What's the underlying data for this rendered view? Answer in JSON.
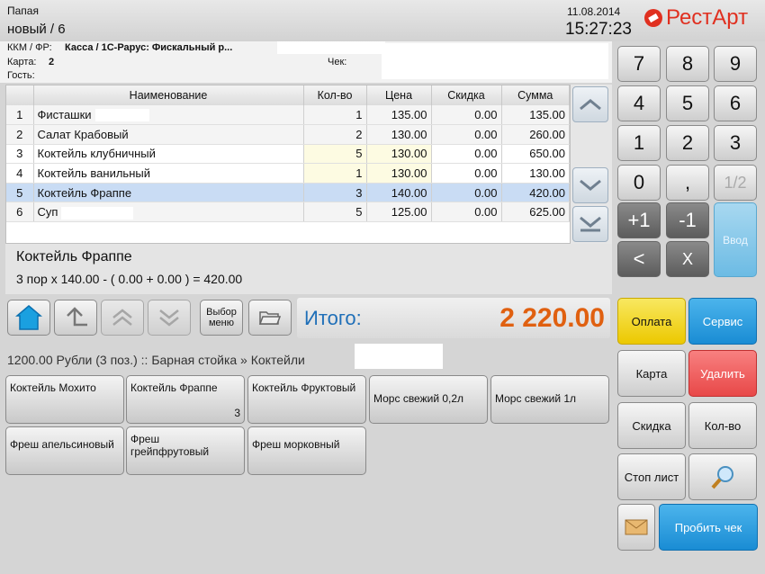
{
  "header": {
    "waiter": "Папая",
    "order": "новый / 6",
    "date": "11.08.2014",
    "time": "15:27:23",
    "brand": "РестАрт",
    "brand_color": "#e03020"
  },
  "info": {
    "kkm_label": "ККМ / ФР:",
    "kkm_value": "Касса  / 1С-Рарус: Фискальный р...",
    "card_label": "Карта:",
    "card_value": "2",
    "check_label": "Чек:",
    "guest_label": "Гость:"
  },
  "table": {
    "columns": [
      "",
      "Наименование",
      "Кол-во",
      "Цена",
      "Скидка",
      "Сумма"
    ],
    "rows": [
      {
        "n": "1",
        "name": "Фисташки",
        "qty": "1",
        "price": "135.00",
        "disc": "0.00",
        "sum": "135.00"
      },
      {
        "n": "2",
        "name": "Салат Крабовый",
        "qty": "2",
        "price": "130.00",
        "disc": "0.00",
        "sum": "260.00"
      },
      {
        "n": "3",
        "name": "Коктейль клубничный",
        "qty": "5",
        "price": "130.00",
        "disc": "0.00",
        "sum": "650.00"
      },
      {
        "n": "4",
        "name": "Коктейль ванильный",
        "qty": "1",
        "price": "130.00",
        "disc": "0.00",
        "sum": "130.00"
      },
      {
        "n": "5",
        "name": "Коктейль Фраппе",
        "qty": "3",
        "price": "140.00",
        "disc": "0.00",
        "sum": "420.00"
      },
      {
        "n": "6",
        "name": "Суп",
        "qty": "5",
        "price": "125.00",
        "disc": "0.00",
        "sum": "625.00"
      }
    ]
  },
  "detail": {
    "name": "Коктейль Фраппе",
    "formula": "3 пор x 140.00 - ( 0.00 + 0.00 ) = 420.00"
  },
  "toolbar": {
    "menu_label": "Выбор меню"
  },
  "total": {
    "label": "Итого:",
    "value": "2 220.00",
    "label_color": "#1f6fb8",
    "value_color": "#e06010"
  },
  "breadcrumb": {
    "text": "1200.00 Рубли (3 поз.)  ::  Барная стойка » Коктейли"
  },
  "products": [
    {
      "label": "Коктейль Мохито",
      "count": ""
    },
    {
      "label": "Коктейль Фраппе",
      "count": "3"
    },
    {
      "label": "Коктейль Фруктовый",
      "count": ""
    },
    {
      "label": "Морс свежий 0,2л",
      "count": ""
    },
    {
      "label": "Морс свежий 1л",
      "count": ""
    },
    {
      "label": "Фреш апельсиновый",
      "count": ""
    },
    {
      "label": "Фреш грейпфрутовый",
      "count": ""
    },
    {
      "label": "Фреш морковный",
      "count": ""
    }
  ],
  "keypad": {
    "keys": [
      "7",
      "8",
      "9",
      "4",
      "5",
      "6",
      "1",
      "2",
      "3",
      "0",
      ",",
      "1/2",
      "+1",
      "-1",
      "<",
      "X"
    ],
    "enter": "Ввод"
  },
  "actions": {
    "pay": "Оплата",
    "service": "Сервис",
    "card": "Карта",
    "delete": "Удалить",
    "discount": "Скидка",
    "qty": "Кол-во",
    "stoplist": "Стоп лист",
    "print": "Пробить чек"
  },
  "colors": {
    "pay": "#f5d820",
    "service": "#2a9ce0",
    "delete": "#f06060",
    "print": "#2a9ce0"
  },
  "icons": [
    "home-icon",
    "arrow-up-icon",
    "double-up-icon",
    "double-down-icon",
    "folder-icon",
    "magnifier-icon",
    "envelope-icon",
    "scroll-up-icon",
    "scroll-down-icon",
    "scroll-bottom-icon"
  ]
}
